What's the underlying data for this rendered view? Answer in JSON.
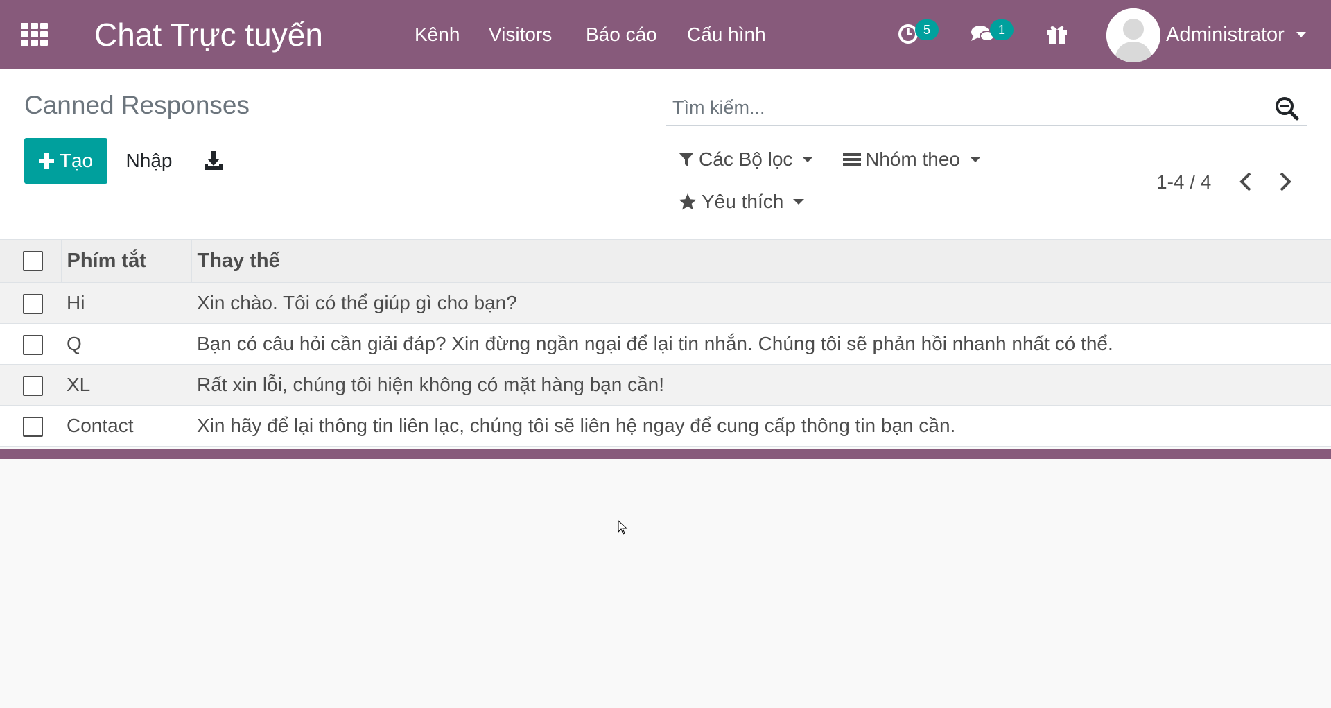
{
  "navbar": {
    "app_title": "Chat Trực tuyến",
    "menu": [
      "Kênh",
      "Visitors",
      "Báo cáo",
      "Cấu hình"
    ],
    "activity_badge": "5",
    "messages_badge": "1",
    "user_name": "Administrator",
    "bg_color": "#875a7b"
  },
  "control_panel": {
    "breadcrumb": "Canned Responses",
    "create_label": "Tạo",
    "import_label": "Nhập",
    "search_placeholder": "Tìm kiếm...",
    "filters_label": "Các Bộ lọc",
    "groupby_label": "Nhóm theo",
    "favorites_label": "Yêu thích",
    "pager_value": "1-4 / 4",
    "accent_color": "#00a09d"
  },
  "table": {
    "headers": {
      "shortcut": "Phím tắt",
      "substitution": "Thay thế"
    },
    "rows": [
      {
        "shortcut": "Hi",
        "substitution": "Xin chào. Tôi có thể giúp gì cho bạn?"
      },
      {
        "shortcut": "Q",
        "substitution": "Bạn có câu hỏi cần giải đáp? Xin đừng ngần ngại để lại tin nhắn. Chúng tôi sẽ phản hồi nhanh nhất có thể."
      },
      {
        "shortcut": "XL",
        "substitution": "Rất xin lỗi, chúng tôi hiện không có mặt hàng bạn cần!"
      },
      {
        "shortcut": "Contact",
        "substitution": "Xin hãy để lại thông tin liên lạc, chúng tôi sẽ liên hệ ngay để cung cấp thông tin bạn cần."
      }
    ]
  },
  "icons": {
    "apps": "apps-grid-icon",
    "activity": "clock-icon",
    "messages": "chat-bubbles-icon",
    "gift": "gift-icon",
    "download": "download-icon",
    "search": "search-icon",
    "filter": "filter-icon",
    "groupby": "list-bars-icon",
    "favorites": "star-icon"
  }
}
